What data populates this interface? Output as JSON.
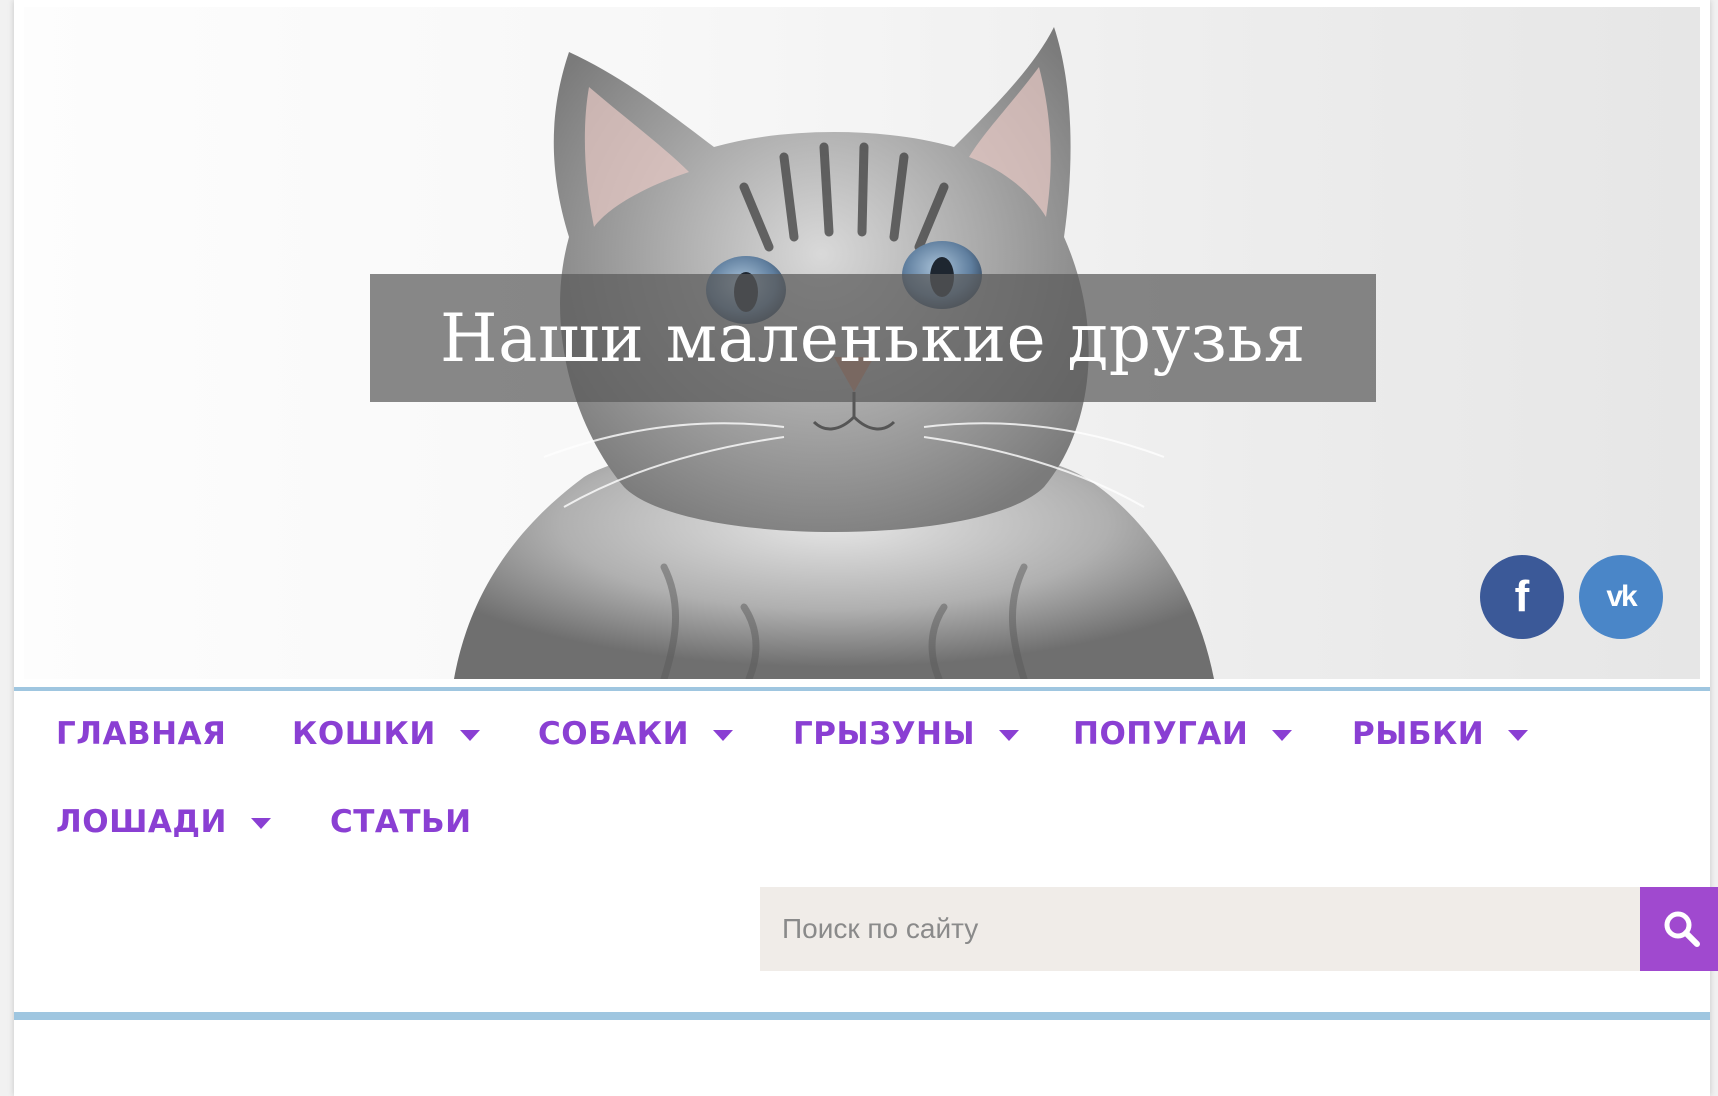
{
  "header": {
    "site_title": "Наши маленькие друзья",
    "social": {
      "facebook_label": "f",
      "vk_label": "vk",
      "facebook_color": "#3b5998",
      "vk_color": "#4a86c8"
    }
  },
  "nav": {
    "items": [
      {
        "label": "ГЛАВНАЯ",
        "has_dropdown": false
      },
      {
        "label": "КОШКИ",
        "has_dropdown": true
      },
      {
        "label": "СОБАКИ",
        "has_dropdown": true
      },
      {
        "label": "ГРЫЗУНЫ",
        "has_dropdown": true
      },
      {
        "label": "ПОПУГАИ",
        "has_dropdown": true
      },
      {
        "label": "РЫБКИ",
        "has_dropdown": true
      },
      {
        "label": "ЛОШАДИ",
        "has_dropdown": true
      },
      {
        "label": "СТАТЬИ",
        "has_dropdown": false
      }
    ],
    "text_color": "#8a3fd3"
  },
  "search": {
    "placeholder": "Поиск по сайту",
    "value": "",
    "button_icon": "search-icon",
    "button_color": "#a049cf"
  },
  "colors": {
    "divider": "#9fc6e0"
  }
}
